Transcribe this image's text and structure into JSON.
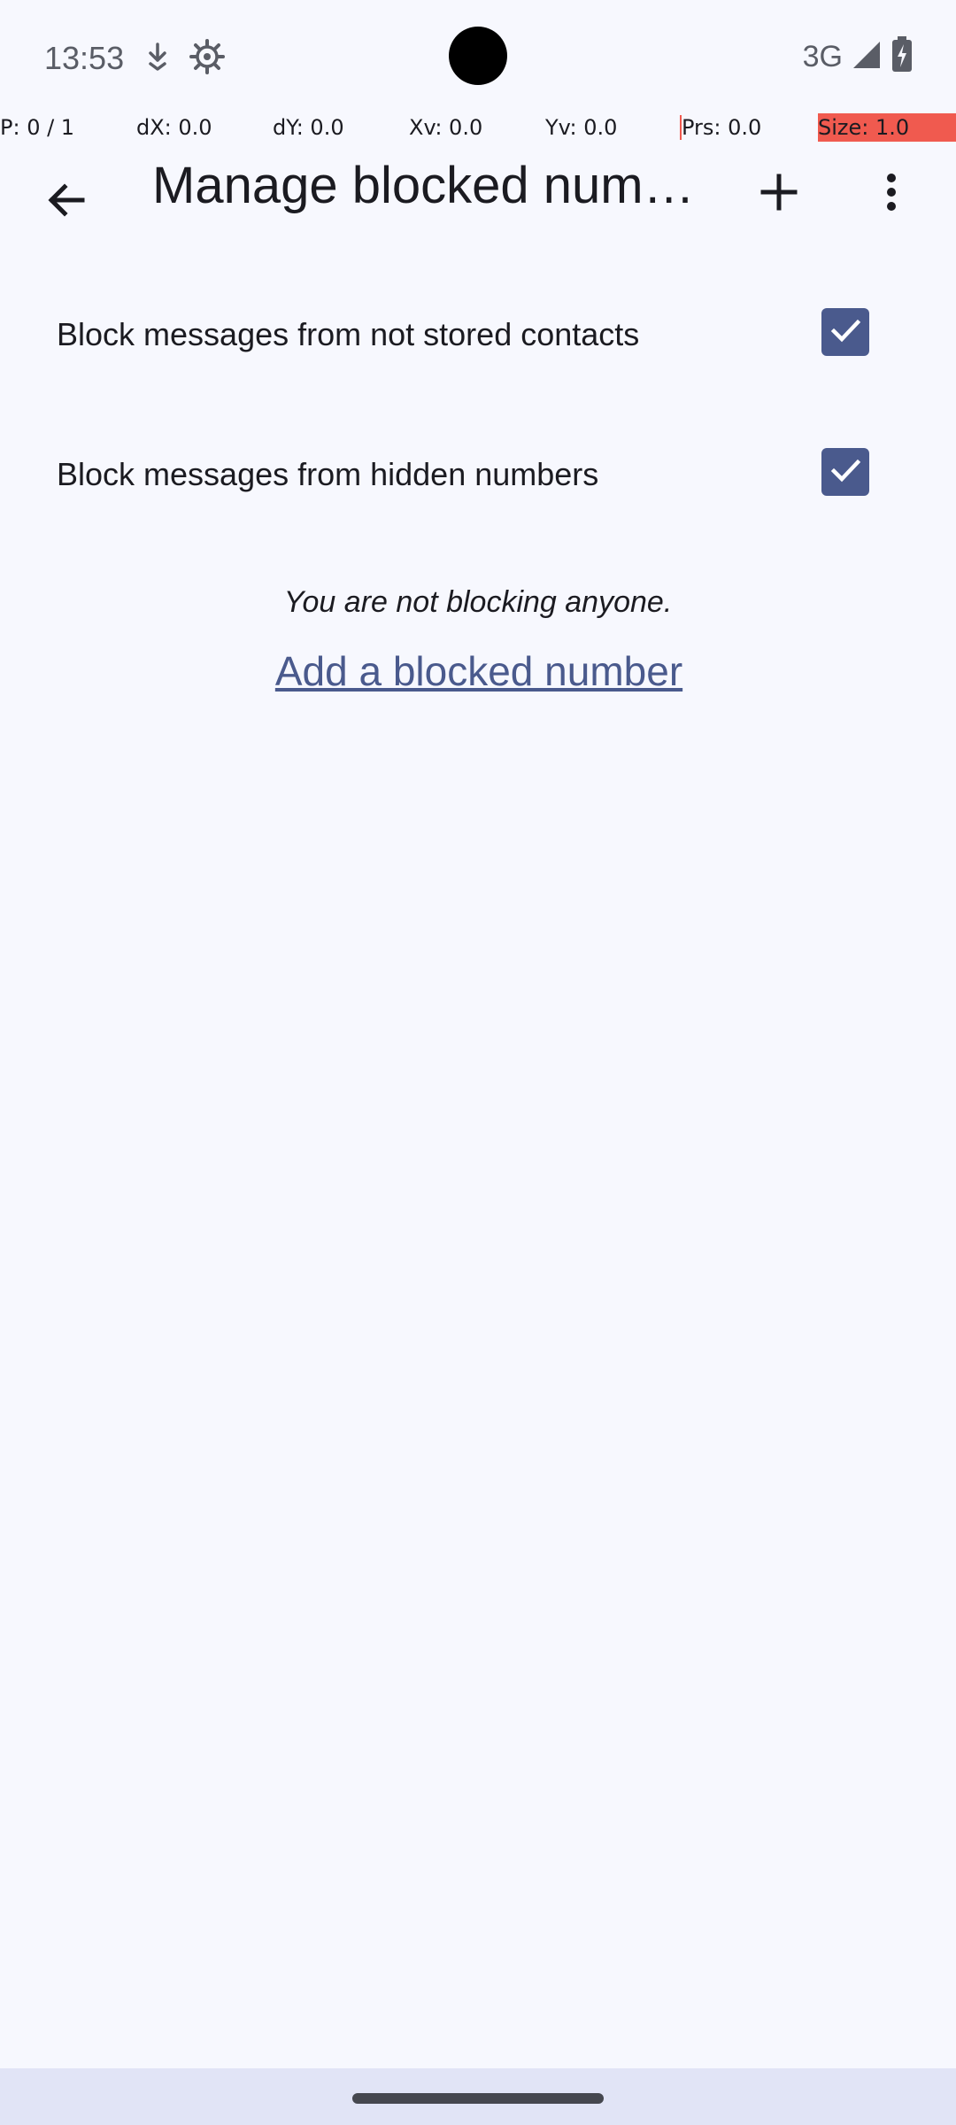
{
  "status_bar": {
    "time": "13:53",
    "network": "3G",
    "icons": [
      "download-icon",
      "settings-gear-icon",
      "signal-icon",
      "battery-charging-icon"
    ]
  },
  "pointer_overlay": {
    "p": "P: 0 / 1",
    "dx": "dX: 0.0",
    "dy": "dY: 0.0",
    "xv": "Xv: 0.0",
    "yv": "Yv: 0.0",
    "prs": "Prs: 0.0",
    "size": "Size: 1.0"
  },
  "app_bar": {
    "back_icon": "arrow-back-icon",
    "title": "Manage blocked numbers",
    "add_icon": "plus-icon",
    "menu_icon": "more-vert-icon"
  },
  "settings": [
    {
      "label": "Block messages from not stored contacts",
      "checked": true
    },
    {
      "label": "Block messages from hidden numbers",
      "checked": true
    }
  ],
  "empty_state": {
    "message": "You are not blocking anyone.",
    "action_label": "Add a blocked number"
  },
  "colors": {
    "background": "#F7F8FE",
    "accent": "#4A5A8D",
    "nav_bar": "#E1E4F6"
  }
}
